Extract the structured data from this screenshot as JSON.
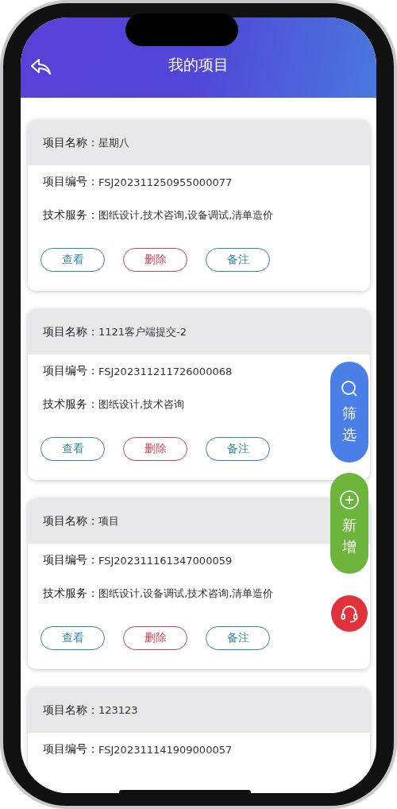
{
  "header": {
    "title": "我的项目"
  },
  "projects": [
    {
      "rows": [
        {
          "label": "项目名称：",
          "value": "星期八"
        },
        {
          "label": "项目编号：",
          "value": "FSJ202311250955000077"
        },
        {
          "label": "技术服务：",
          "value": "图纸设计,技术咨询,设备调试,清单造价"
        }
      ],
      "actions": [
        {
          "label": "查看",
          "color": "#2f86a8"
        },
        {
          "label": "删除",
          "color": "#c5485a"
        },
        {
          "label": "备注",
          "color": "#2f86a8"
        }
      ]
    },
    {
      "rows": [
        {
          "label": "项目名称：",
          "value": "1121客户端提交-2"
        },
        {
          "label": "项目编号：",
          "value": "FSJ202311211726000068"
        },
        {
          "label": "技术服务：",
          "value": "图纸设计,技术咨询"
        }
      ],
      "actions": [
        {
          "label": "查看",
          "color": "#2f86a8"
        },
        {
          "label": "删除",
          "color": "#c5485a"
        },
        {
          "label": "备注",
          "color": "#2f86a8"
        }
      ]
    },
    {
      "rows": [
        {
          "label": "项目名称：",
          "value": "项目"
        },
        {
          "label": "项目编号：",
          "value": "FSJ202311161347000059"
        },
        {
          "label": "技术服务：",
          "value": "图纸设计,设备调试,技术咨询,清单造价"
        }
      ],
      "actions": [
        {
          "label": "查看",
          "color": "#2f86a8"
        },
        {
          "label": "删除",
          "color": "#c5485a"
        },
        {
          "label": "备注",
          "color": "#2f86a8"
        }
      ]
    },
    {
      "rows": [
        {
          "label": "项目名称：",
          "value": "123123"
        },
        {
          "label": "项目编号：",
          "value": "FSJ202311141909000057"
        }
      ]
    }
  ],
  "floating_buttons": [
    {
      "kind": "filter",
      "label": "筛选",
      "color": "#4a7fe8"
    },
    {
      "kind": "add",
      "label": "新增",
      "color": "#6cb43c"
    },
    {
      "kind": "support",
      "color": "#e0323a"
    }
  ]
}
